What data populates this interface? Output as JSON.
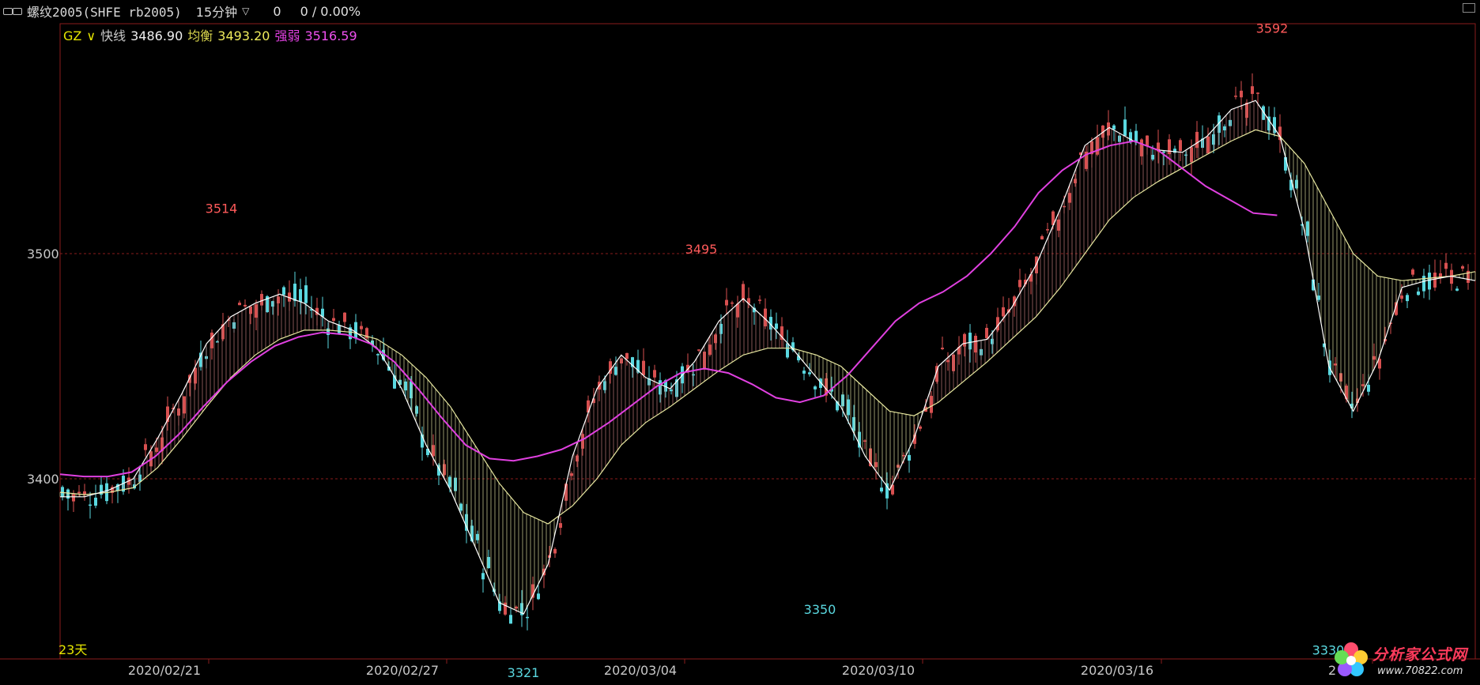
{
  "header": {
    "symbol": "螺纹2005(SHFE rb2005)",
    "period": "15分钟",
    "change": "0",
    "pct": "0 / 0.00%"
  },
  "legend": {
    "indicator": "GZ",
    "fast_label": "快线",
    "fast_value": "3486.90",
    "balance_label": "均衡",
    "balance_value": "3493.20",
    "strong_label": "强弱",
    "strong_value": "3516.59"
  },
  "bars_label": "23天",
  "logo": {
    "title": "分析家公式网",
    "url": "www.70822.com"
  },
  "colors": {
    "up": "#d85050",
    "down": "#5ad8e0",
    "fast_line": "#ffffff",
    "balance_line": "#e8e8a0",
    "strong_line": "#e040e0",
    "grid": "#8a1c1c",
    "high_label": "#ff5a5a",
    "low_label": "#5ad8e0"
  },
  "chart_data": {
    "type": "line",
    "title": "",
    "ylim": [
      3320,
      3600
    ],
    "y_ticks": [
      "3500",
      "3400"
    ],
    "x_ticks": [
      "2020/02/21",
      "2020/02/27",
      "2020/03/04",
      "2020/03/10",
      "2020/03/16",
      "2"
    ],
    "annotations": [
      {
        "text": "3514",
        "kind": "high",
        "at": "2020/02/24"
      },
      {
        "text": "3321",
        "kind": "low",
        "at": "2020/03/02"
      },
      {
        "text": "3495",
        "kind": "high",
        "at": "2020/03/05"
      },
      {
        "text": "3350",
        "kind": "low",
        "at": "2020/03/09"
      },
      {
        "text": "3592",
        "kind": "high",
        "at": "2020/03/18"
      },
      {
        "text": "3330",
        "kind": "low",
        "at": "2020/03/19"
      }
    ],
    "series": [
      {
        "name": "快线",
        "key": "fast",
        "values": [
          3392,
          3392,
          3395,
          3400,
          3418,
          3438,
          3460,
          3472,
          3478,
          3482,
          3478,
          3470,
          3466,
          3458,
          3440,
          3415,
          3395,
          3370,
          3345,
          3340,
          3362,
          3410,
          3440,
          3455,
          3445,
          3440,
          3452,
          3470,
          3480,
          3470,
          3458,
          3445,
          3432,
          3410,
          3395,
          3418,
          3450,
          3460,
          3462,
          3476,
          3495,
          3520,
          3548,
          3556,
          3550,
          3546,
          3545,
          3552,
          3564,
          3568,
          3552,
          3510,
          3450,
          3430,
          3452,
          3485,
          3488,
          3490,
          3488
        ]
      },
      {
        "name": "均衡",
        "key": "balance",
        "values": [
          3394,
          3393,
          3394,
          3396,
          3405,
          3418,
          3432,
          3445,
          3455,
          3462,
          3466,
          3466,
          3465,
          3462,
          3455,
          3445,
          3432,
          3415,
          3398,
          3385,
          3380,
          3388,
          3400,
          3415,
          3425,
          3432,
          3440,
          3448,
          3455,
          3458,
          3458,
          3455,
          3450,
          3440,
          3430,
          3428,
          3434,
          3443,
          3452,
          3462,
          3472,
          3485,
          3500,
          3515,
          3525,
          3532,
          3538,
          3544,
          3550,
          3555,
          3552,
          3540,
          3520,
          3500,
          3490,
          3488,
          3489,
          3490,
          3492
        ]
      },
      {
        "name": "强弱",
        "key": "strong",
        "values": [
          3402,
          3401,
          3401,
          3403,
          3410,
          3420,
          3432,
          3443,
          3452,
          3459,
          3463,
          3465,
          3464,
          3460,
          3452,
          3440,
          3427,
          3415,
          3409,
          3408,
          3410,
          3413,
          3418,
          3425,
          3433,
          3441,
          3447,
          3449,
          3447,
          3442,
          3436,
          3434,
          3437,
          3446,
          3458,
          3470,
          3478,
          3483,
          3490,
          3500,
          3512,
          3527,
          3537,
          3544,
          3548,
          3550,
          3546,
          3538,
          3530,
          3524,
          3518,
          3517
        ]
      }
    ]
  }
}
